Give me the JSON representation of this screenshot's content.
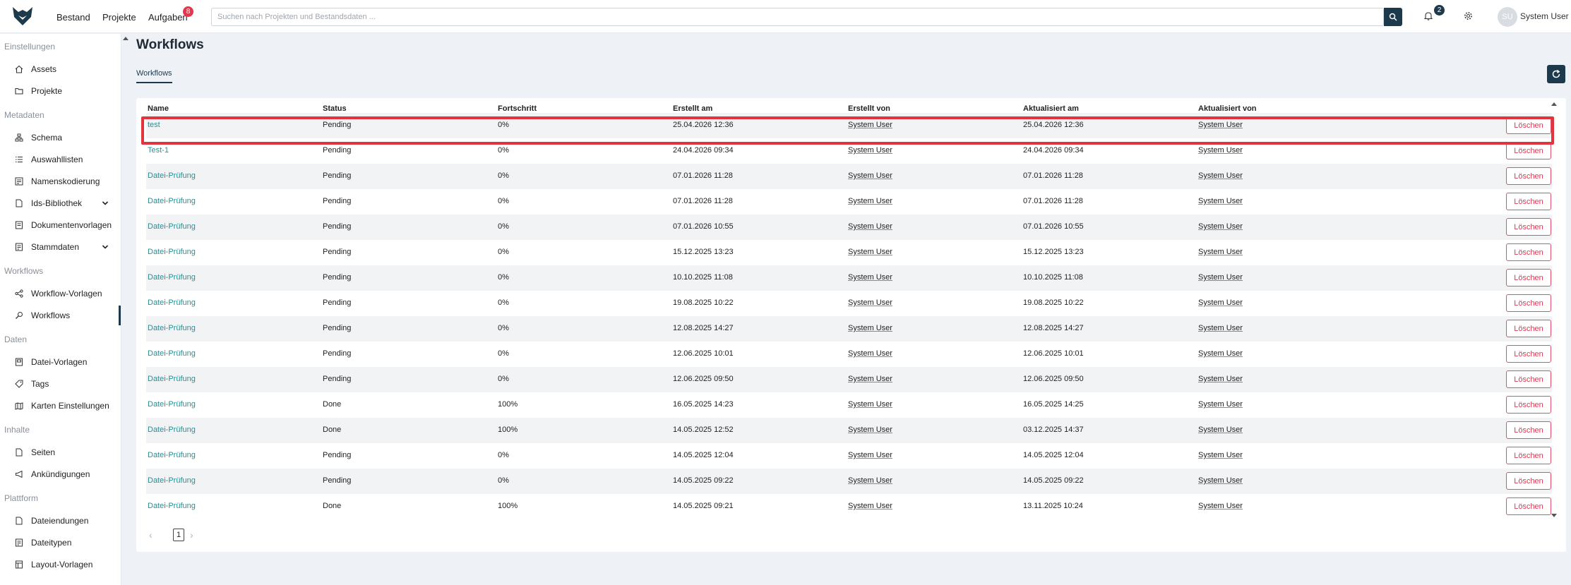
{
  "topbar": {
    "nav": [
      "Bestand",
      "Projekte",
      "Aufgaben"
    ],
    "tasks_badge": "8",
    "search_placeholder": "Suchen nach Projekten und Bestandsdaten ...",
    "notifications_badge": "2",
    "user_initials": "SU",
    "user_name": "System User"
  },
  "sidebar": {
    "sections": [
      {
        "title": "Einstellungen",
        "items": [
          {
            "label": "Assets"
          },
          {
            "label": "Projekte"
          }
        ]
      },
      {
        "title": "Metadaten",
        "items": [
          {
            "label": "Schema"
          },
          {
            "label": "Auswahllisten"
          },
          {
            "label": "Namenskodierung"
          },
          {
            "label": "Ids-Bibliothek"
          },
          {
            "label": "Dokumentenvorlagen"
          },
          {
            "label": "Stammdaten"
          }
        ]
      },
      {
        "title": "Workflows",
        "items": [
          {
            "label": "Workflow-Vorlagen"
          },
          {
            "label": "Workflows"
          }
        ]
      },
      {
        "title": "Daten",
        "items": [
          {
            "label": "Datei-Vorlagen"
          },
          {
            "label": "Tags"
          },
          {
            "label": "Karten Einstellungen"
          }
        ]
      },
      {
        "title": "Inhalte",
        "items": [
          {
            "label": "Seiten"
          },
          {
            "label": "Ankündigungen"
          }
        ]
      },
      {
        "title": "Plattform",
        "items": [
          {
            "label": "Dateiendungen"
          },
          {
            "label": "Dateitypen"
          },
          {
            "label": "Layout-Vorlagen"
          }
        ]
      }
    ]
  },
  "main": {
    "title": "Workflows",
    "tab": "Workflows",
    "columns": [
      "Name",
      "Status",
      "Fortschritt",
      "Erstellt am",
      "Erstellt von",
      "Aktualisiert am",
      "Aktualisiert von"
    ],
    "delete_label": "Löschen",
    "rows": [
      [
        "test",
        "Pending",
        "0%",
        "25.04.2026 12:36",
        "System User",
        "25.04.2026 12:36",
        "System User"
      ],
      [
        "Test-1",
        "Pending",
        "0%",
        "24.04.2026 09:34",
        "System User",
        "24.04.2026 09:34",
        "System User"
      ],
      [
        "Datei-Prüfung",
        "Pending",
        "0%",
        "07.01.2026 11:28",
        "System User",
        "07.01.2026 11:28",
        "System User"
      ],
      [
        "Datei-Prüfung",
        "Pending",
        "0%",
        "07.01.2026 11:28",
        "System User",
        "07.01.2026 11:28",
        "System User"
      ],
      [
        "Datei-Prüfung",
        "Pending",
        "0%",
        "07.01.2026 10:55",
        "System User",
        "07.01.2026 10:55",
        "System User"
      ],
      [
        "Datei-Prüfung",
        "Pending",
        "0%",
        "15.12.2025 13:23",
        "System User",
        "15.12.2025 13:23",
        "System User"
      ],
      [
        "Datei-Prüfung",
        "Pending",
        "0%",
        "10.10.2025 11:08",
        "System User",
        "10.10.2025 11:08",
        "System User"
      ],
      [
        "Datei-Prüfung",
        "Pending",
        "0%",
        "19.08.2025 10:22",
        "System User",
        "19.08.2025 10:22",
        "System User"
      ],
      [
        "Datei-Prüfung",
        "Pending",
        "0%",
        "12.08.2025 14:27",
        "System User",
        "12.08.2025 14:27",
        "System User"
      ],
      [
        "Datei-Prüfung",
        "Pending",
        "0%",
        "12.06.2025 10:01",
        "System User",
        "12.06.2025 10:01",
        "System User"
      ],
      [
        "Datei-Prüfung",
        "Pending",
        "0%",
        "12.06.2025 09:50",
        "System User",
        "12.06.2025 09:50",
        "System User"
      ],
      [
        "Datei-Prüfung",
        "Done",
        "100%",
        "16.05.2025 14:23",
        "System User",
        "16.05.2025 14:25",
        "System User"
      ],
      [
        "Datei-Prüfung",
        "Done",
        "100%",
        "14.05.2025 12:52",
        "System User",
        "03.12.2025 14:37",
        "System User"
      ],
      [
        "Datei-Prüfung",
        "Pending",
        "0%",
        "14.05.2025 12:04",
        "System User",
        "14.05.2025 12:04",
        "System User"
      ],
      [
        "Datei-Prüfung",
        "Pending",
        "0%",
        "14.05.2025 09:22",
        "System User",
        "14.05.2025 09:22",
        "System User"
      ],
      [
        "Datei-Prüfung",
        "Done",
        "100%",
        "14.05.2025 09:21",
        "System User",
        "13.11.2025 10:24",
        "System User"
      ]
    ],
    "pagination": {
      "prev": "‹",
      "page": "1",
      "next": "›"
    }
  },
  "colors": {
    "accent": "#1d3a4d",
    "link": "#2a8f93",
    "danger": "#d63b57",
    "badge": "#e8344d",
    "highlight": "#e2343c"
  }
}
